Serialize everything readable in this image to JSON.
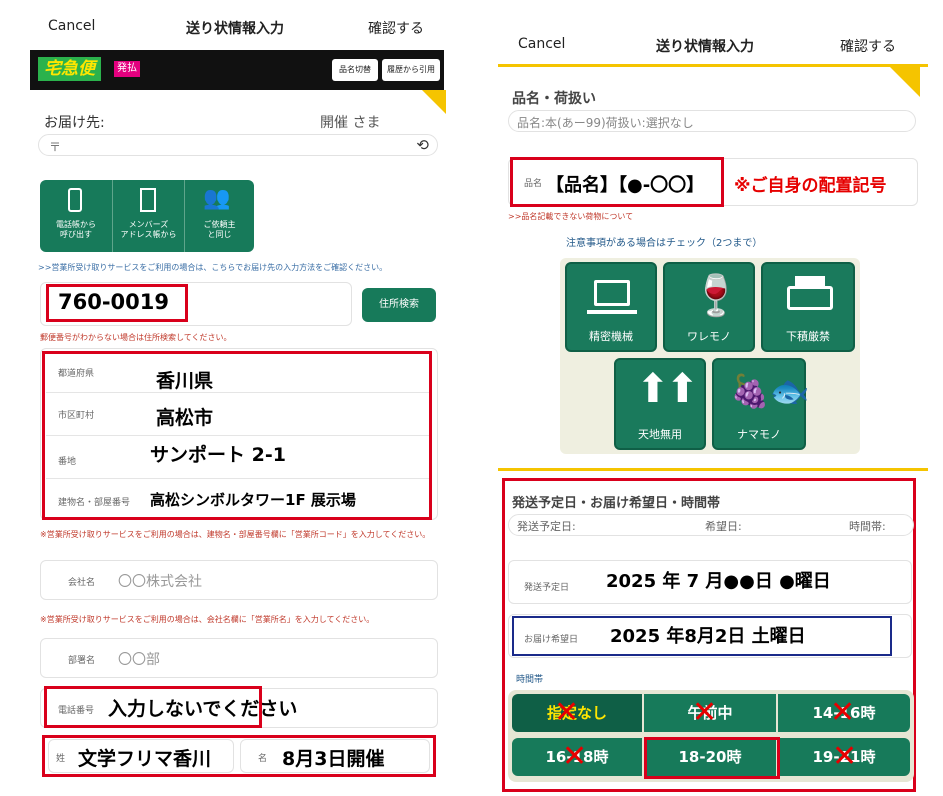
{
  "left": {
    "header": {
      "cancel": "Cancel",
      "title": "送り状情報入力",
      "confirm": "確認する"
    },
    "brand": {
      "logo": "宅急便",
      "badge": "発払",
      "btn_product": "品名切替",
      "btn_history": "履歴から引用"
    },
    "recipient": {
      "label": "お届け先:",
      "name": "開催 さま",
      "postal_mark": "〒"
    },
    "address_buttons": {
      "phone_book": "電話帳から\n呼び出す",
      "member_book": "メンバーズ\nアドレス帳から",
      "self": "ご依頼主\nと同じ"
    },
    "notes": {
      "receive_service": ">>営業所受け取りサービスをご利用の場合は、こちらでお届け先の入力方法をご確認ください。",
      "unknown_postal": "郵便番号がわからない場合は住所検索してください。",
      "branch_code": "※営業所受け取りサービスをご利用の場合は、建物名・部屋番号欄に「営業所コード」を入力してください。",
      "company_name": "※営業所受け取りサービスをご利用の場合は、会社名欄に「営業所名」を入力してください。"
    },
    "postal": {
      "value": "760-0019",
      "search_button": "住所検索"
    },
    "address": {
      "prefecture_label": "都道府県",
      "prefecture": "香川県",
      "city_label": "市区町村",
      "city": "高松市",
      "street_label": "番地",
      "street": "サンポート 2-1",
      "building_label": "建物名・部屋番号",
      "building": "高松シンボルタワー1F 展示場"
    },
    "company": {
      "label": "会社名",
      "value": "〇〇株式会社"
    },
    "department": {
      "label": "部署名",
      "value": "〇〇部"
    },
    "phone": {
      "label": "電話番号",
      "value": "入力しないでください"
    },
    "name_fields": {
      "last_label": "姓",
      "last": "文学フリマ香川",
      "first_label": "名",
      "first": "8月3日開催"
    }
  },
  "right": {
    "header": {
      "cancel": "Cancel",
      "title": "送り状情報入力",
      "confirm": "確認する"
    },
    "product": {
      "section_title": "品名・荷扱い",
      "summary": "品名:本(あー99)荷扱い:選択なし",
      "field_label": "品名",
      "field_value": "【品名】【●-〇〇】",
      "annotation": "※ご自身の配置記号",
      "note": ">>品名記載できない荷物について",
      "caution_title": "注意事項がある場合はチェック（2つまで）"
    },
    "handling": [
      {
        "label": "精密機械",
        "icon": "laptop-icon"
      },
      {
        "label": "ワレモノ",
        "icon": "broken-glass-icon"
      },
      {
        "label": "下積厳禁",
        "icon": "printer-icon"
      },
      {
        "label": "天地無用",
        "icon": "up-arrows-icon"
      },
      {
        "label": "ナマモノ",
        "icon": "fresh-food-icon"
      }
    ],
    "schedule": {
      "section_title": "発送予定日・お届け希望日・時間帯",
      "summary_ship": "発送予定日:",
      "summary_desired": "希望日:",
      "summary_time": "時間帯:",
      "ship_label": "発送予定日",
      "ship_value": "2025 年 7 月●●日 ●曜日",
      "delivery_label": "お届け希望日",
      "delivery_value": "2025 年8月2日 土曜日",
      "time_label": "時間帯",
      "slots": [
        "指定なし",
        "午前中",
        "14-16時",
        "16-18時",
        "18-20時",
        "19-21時"
      ]
    }
  }
}
